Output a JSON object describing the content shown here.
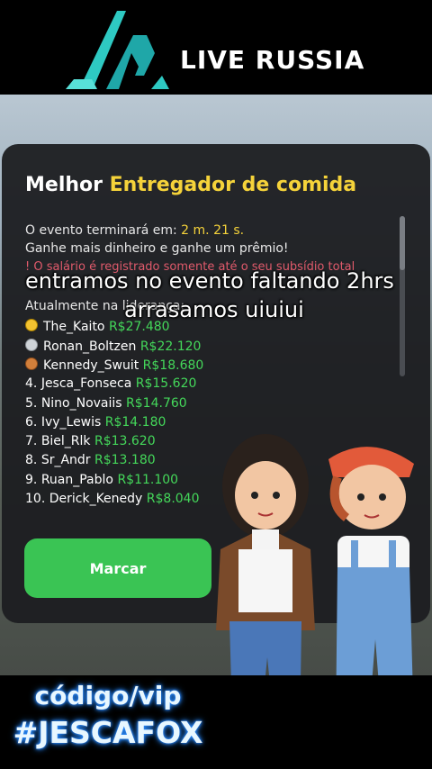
{
  "header": {
    "brand": "LIVE RUSSIA",
    "logo_icon": "lr-logo-icon"
  },
  "panel": {
    "title_prefix": "Melhor",
    "title_accent": "Entregador de comida",
    "ends_label": "O evento terminará em:",
    "ends_value": "2 m. 21 s.",
    "tagline": "Ganhe mais dinheiro e ganhe um prêmio!",
    "warning": "! O salário é registrado somente até o seu subsídio total",
    "current_label": "Atualmente na liderança:",
    "leaders": [
      {
        "pos": "",
        "medal": "gold",
        "name": "The_Kaito",
        "amount": "R$27.480"
      },
      {
        "pos": "",
        "medal": "silver",
        "name": "Ronan_Boltzen",
        "amount": "R$22.120"
      },
      {
        "pos": "",
        "medal": "bronze",
        "name": "Kennedy_Swuit",
        "amount": "R$18.680"
      },
      {
        "pos": "4.",
        "medal": "",
        "name": "Jesca_Fonseca",
        "amount": "R$15.620"
      },
      {
        "pos": "5.",
        "medal": "",
        "name": "Nino_Novaiis",
        "amount": "R$14.760"
      },
      {
        "pos": "6.",
        "medal": "",
        "name": "Ivy_Lewis",
        "amount": "R$14.180"
      },
      {
        "pos": "7.",
        "medal": "",
        "name": "Biel_Rlk",
        "amount": "R$13.620"
      },
      {
        "pos": "8.",
        "medal": "",
        "name": "Sr_Andr",
        "amount": "R$13.180"
      },
      {
        "pos": "9.",
        "medal": "",
        "name": "Ruan_Pablo",
        "amount": "R$11.100"
      },
      {
        "pos": "10.",
        "medal": "",
        "name": "Derick_Kenedy",
        "amount": "R$8.040"
      }
    ],
    "button_label": "Marcar"
  },
  "overlay": {
    "line1": "entramos no evento faltando 2hrs",
    "line2": "arrasamos uiuiui"
  },
  "promo": {
    "line1": "código/vip",
    "line2": "#JESCAFOX"
  },
  "colors": {
    "accent_yellow": "#f5d33a",
    "money_green": "#44d85a",
    "button_green": "#3ac454",
    "warning_red": "#e05a6b"
  }
}
